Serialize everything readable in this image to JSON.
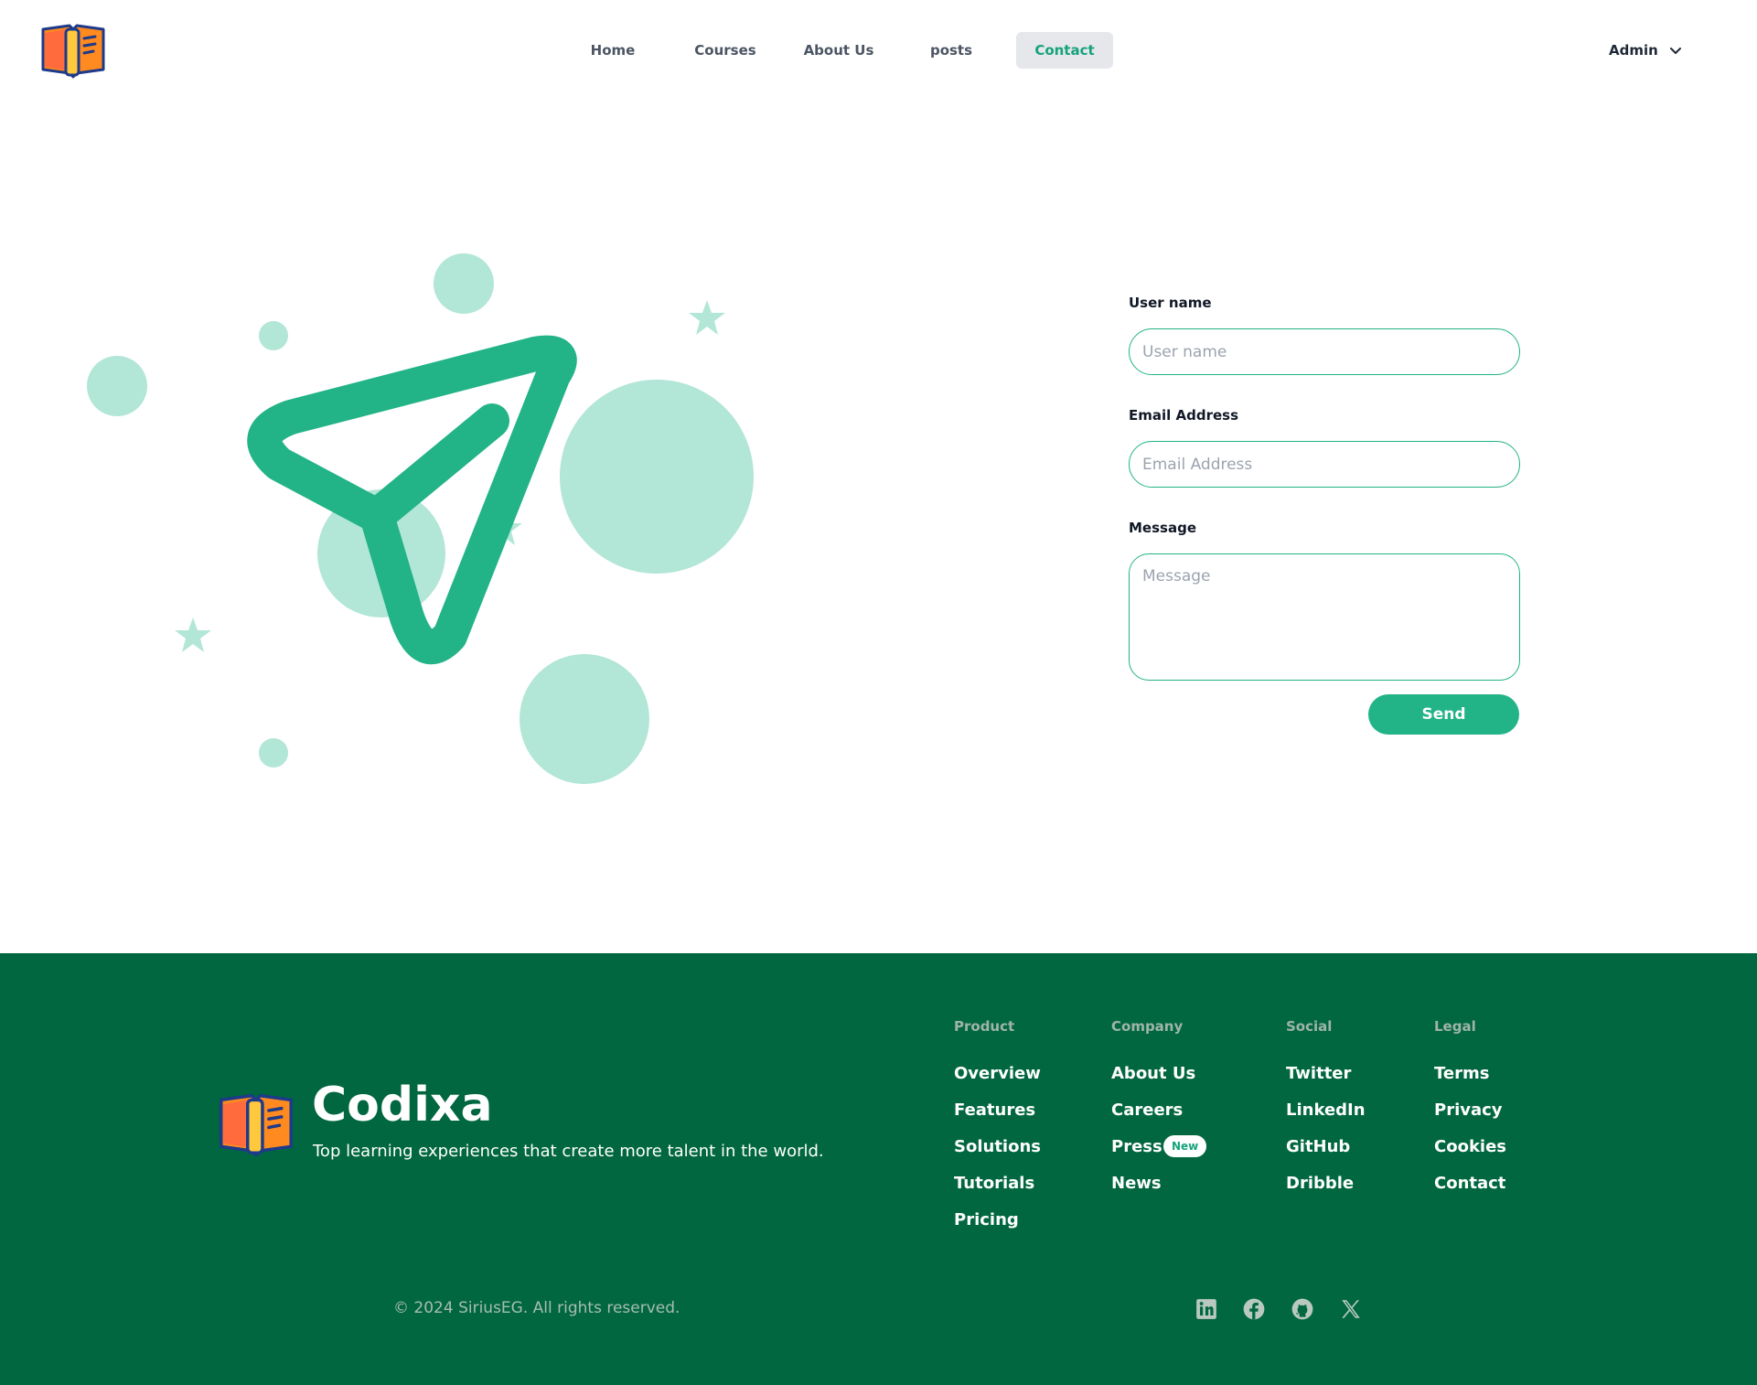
{
  "header": {
    "logo_name": "open-book-logo",
    "nav": [
      {
        "label": "Home"
      },
      {
        "label": "Courses"
      },
      {
        "label": "About Us"
      },
      {
        "label": "posts"
      },
      {
        "label": "Contact",
        "active": true
      }
    ],
    "user_menu": {
      "label": "Admin",
      "icon": "chevron-down-icon"
    }
  },
  "illustration": {
    "icon": "send-arrow-icon",
    "decoration": [
      "circle",
      "star"
    ]
  },
  "form": {
    "username": {
      "label": "User name",
      "placeholder": "User name",
      "value": ""
    },
    "email": {
      "label": "Email Address",
      "placeholder": "Email Address",
      "value": ""
    },
    "message": {
      "label": "Message",
      "placeholder": "Message",
      "value": ""
    },
    "send_label": "Send"
  },
  "footer": {
    "brand": {
      "name": "Codixa",
      "tagline": "Top learning experiences that create more talent in the world."
    },
    "columns": [
      {
        "heading": "Product",
        "links": [
          "Overview",
          "Features",
          "Solutions",
          "Tutorials",
          "Pricing"
        ]
      },
      {
        "heading": "Company",
        "links": [
          "About Us",
          "Careers",
          "Press",
          "News"
        ],
        "badge": "New"
      },
      {
        "heading": "Social",
        "links": [
          "Twitter",
          "LinkedIn",
          "GitHub",
          "Dribble"
        ]
      },
      {
        "heading": "Legal",
        "links": [
          "Terms",
          "Privacy",
          "Cookies",
          "Contact"
        ]
      }
    ],
    "copyright": "© 2024 SiriusEG. All rights reserved.",
    "social_icons": [
      "linkedin-icon",
      "facebook-icon",
      "github-icon",
      "x-icon"
    ]
  },
  "colors": {
    "accent": "#22b386",
    "footer_bg": "#016740",
    "mint": "#b2e6d6"
  }
}
